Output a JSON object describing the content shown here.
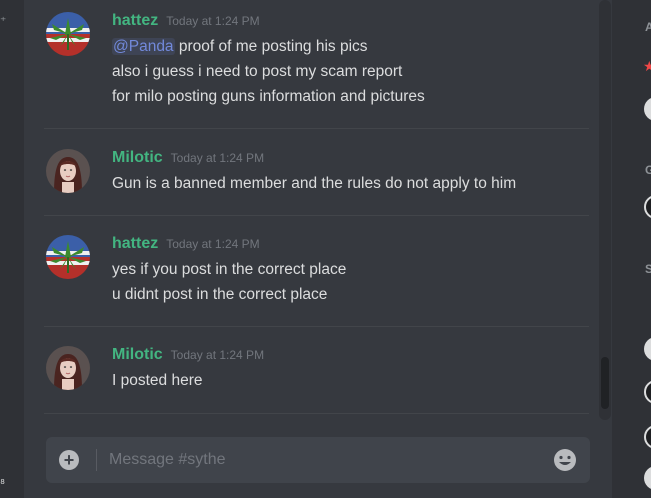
{
  "channel": {
    "input_placeholder": "Message #sythe"
  },
  "messages": [
    {
      "username": "hattez",
      "user_color": "#43b581",
      "avatar_icon": "weed-flag-avatar",
      "timestamp": "Today at 1:24 PM",
      "mention": "@Panda",
      "lines": [
        " proof of me posting his pics",
        "also i guess i need to post my scam report",
        "for milo posting guns information and pictures"
      ]
    },
    {
      "username": "Milotic",
      "user_color": "#43b581",
      "avatar_icon": "girl-portrait-avatar",
      "timestamp": "Today at 1:24 PM",
      "lines": [
        "Gun is a banned member and the rules do not apply to him"
      ]
    },
    {
      "username": "hattez",
      "user_color": "#43b581",
      "avatar_icon": "weed-flag-avatar",
      "timestamp": "Today at 1:24 PM",
      "lines": [
        "yes if you post in the correct place",
        "u didnt post in the correct place"
      ]
    },
    {
      "username": "Milotic",
      "user_color": "#43b581",
      "avatar_icon": "girl-portrait-avatar",
      "timestamp": "Today at 1:24 PM",
      "lines": [
        "I posted here"
      ]
    }
  ],
  "member_list": {
    "headers": [
      "A",
      "G",
      "S"
    ]
  },
  "colors": {
    "background": "#36393f",
    "username": "#43b581",
    "mention": "#7289da"
  }
}
